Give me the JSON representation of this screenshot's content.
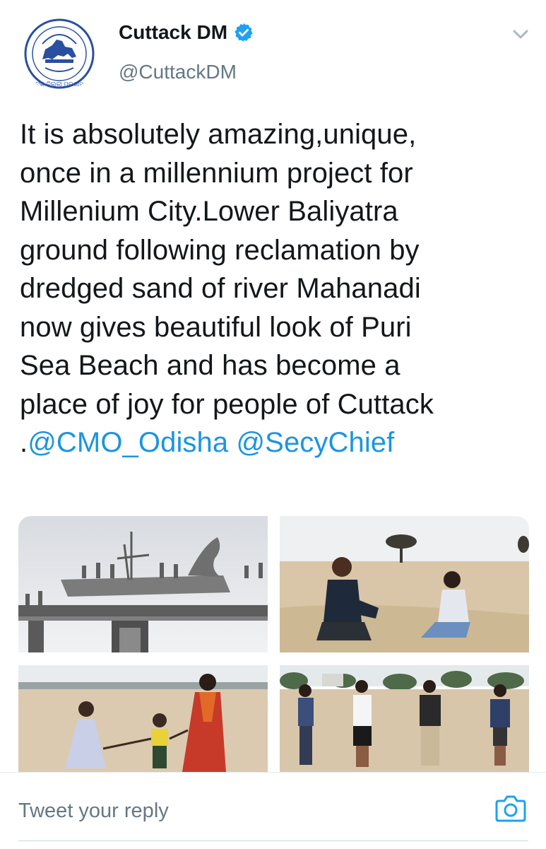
{
  "tweet": {
    "author": {
      "display_name": "Cuttack DM",
      "handle": "@CuttackDM",
      "verified": true,
      "avatar_caption": "କଟକ ଜିଲ୍ଲା ପ୍ରଶାସନ"
    },
    "text_lines": [
      "It is absolutely amazing,unique,",
      "once in a millennium project for",
      "Millenium City.Lower Baliyatra",
      "ground following reclamation by",
      "dredged sand of river Mahanadi",
      "now gives beautiful look of Puri",
      "Sea Beach and has become a",
      "place of joy for people of Cuttack"
    ],
    "last_line_prefix": ".",
    "mentions": [
      "@CMO_Odisha",
      "@SecyChief"
    ],
    "media_count": 4
  },
  "reply": {
    "placeholder": "Tweet your reply"
  },
  "icons": {
    "verified": "verified-badge-icon",
    "caret": "chevron-down-icon",
    "camera": "camera-icon"
  },
  "colors": {
    "link": "#1b95e0",
    "text": "#14171a",
    "muted": "#657786",
    "verified": "#1da1f2"
  }
}
